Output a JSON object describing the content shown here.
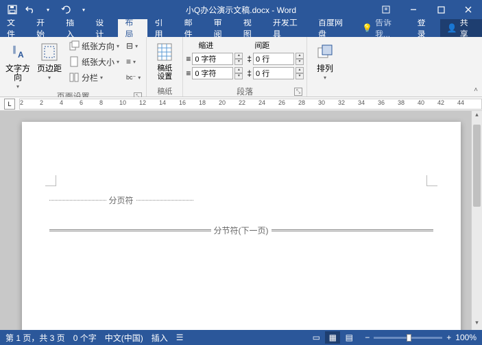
{
  "title": "小Q办公演示文稿.docx - Word",
  "tabs": {
    "file": "文件",
    "home": "开始",
    "insert": "插入",
    "design": "设计",
    "layout": "布局",
    "references": "引用",
    "mailings": "邮件",
    "review": "审阅",
    "view": "视图",
    "developer": "开发工具",
    "baidu": "百度网盘"
  },
  "tell": "告诉我...",
  "login": "登录",
  "share": "共享",
  "ribbon": {
    "textdir": "文字方向",
    "margins": "页边距",
    "orientation": "纸张方向",
    "size": "纸张大小",
    "columns": "分栏",
    "pagesetup": "页面设置",
    "manuscript": "稿纸\n设置",
    "manuscript_group": "稿纸",
    "indent_label": "缩进",
    "spacing_label": "间距",
    "indent_left": "0 字符",
    "indent_right": "0 字符",
    "space_before": "0 行",
    "space_after": "0 行",
    "paragraph": "段落",
    "arrange": "排列"
  },
  "ruler_numbers": [
    2,
    2,
    4,
    6,
    8,
    10,
    12,
    14,
    16,
    18,
    20,
    22,
    24,
    26,
    28,
    30,
    32,
    34,
    36,
    38,
    40,
    42,
    44
  ],
  "doc": {
    "pagebreak": "分页符",
    "section": "分节符(下一页)"
  },
  "status": {
    "page": "第 1 页，共 3 页",
    "words": "0 个字",
    "lang": "中文(中国)",
    "mode": "插入",
    "zoom": "100%"
  }
}
